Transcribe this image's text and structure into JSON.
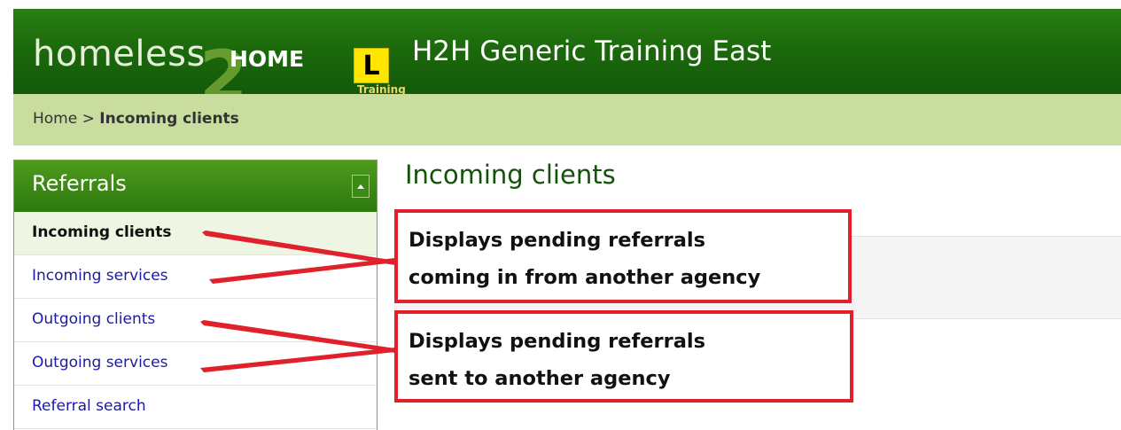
{
  "header": {
    "logo": {
      "homeless": "homeless",
      "two": "2",
      "home": "HOME",
      "plate": "L",
      "training": "Training"
    },
    "site_title": "H2H Generic Training East"
  },
  "breadcrumb": {
    "home": "Home",
    "separator": ">",
    "current": "Incoming clients"
  },
  "sidebar": {
    "title": "Referrals",
    "collapse_icon": "triangle-up-icon",
    "items": [
      {
        "label": "Incoming clients",
        "active": true
      },
      {
        "label": "Incoming services",
        "active": false
      },
      {
        "label": "Outgoing clients",
        "active": false
      },
      {
        "label": "Outgoing services",
        "active": false
      },
      {
        "label": "Referral search",
        "active": false
      }
    ]
  },
  "main": {
    "title": "Incoming clients"
  },
  "annotations": [
    {
      "line1": "Displays pending referrals",
      "line2": "coming in from another agency"
    },
    {
      "line1": "Displays pending referrals",
      "line2": "sent to another agency"
    }
  ],
  "colors": {
    "header_green": "#1c6a0c",
    "breadcrumb_bg": "#c9dd9e",
    "link_blue": "#1a1aa6",
    "annotation_red": "#e0202a"
  }
}
